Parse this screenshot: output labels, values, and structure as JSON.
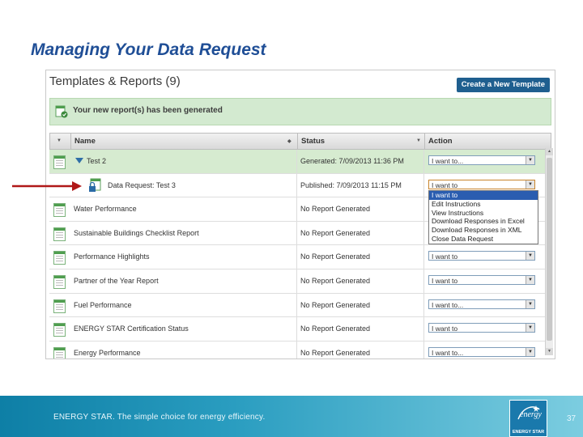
{
  "slide": {
    "title": "Managing Your Data Request",
    "page_number": "37"
  },
  "panel": {
    "title": "Templates & Reports (9)",
    "create_button": "Create a New Template",
    "banner": "Your new report(s) has been generated"
  },
  "table": {
    "headers": {
      "name": "Name",
      "status": "Status",
      "action": "Action"
    },
    "rows": [
      {
        "name": "Test 2",
        "status": "Generated: 7/09/2013 11:36 PM",
        "action": "I want to..."
      },
      {
        "name": "Data Request: Test 3",
        "status": "Published: 7/09/2013 11:15 PM",
        "action": "I want to"
      },
      {
        "name": "Water Performance",
        "status": "No Report Generated",
        "action": "I want to..."
      },
      {
        "name": "Sustainable Buildings Checklist Report",
        "status": "No Report Generated",
        "action": "I want to..."
      },
      {
        "name": "Performance Highlights",
        "status": "No Report Generated",
        "action": "I want to"
      },
      {
        "name": "Partner of the Year Report",
        "status": "No Report Generated",
        "action": "I want to"
      },
      {
        "name": "Fuel Performance",
        "status": "No Report Generated",
        "action": "I want to..."
      },
      {
        "name": "ENERGY STAR Certification Status",
        "status": "No Report Generated",
        "action": "I want to"
      },
      {
        "name": "Energy Performance",
        "status": "No Report Generated",
        "action": "I want to..."
      }
    ]
  },
  "dropdown": {
    "options": [
      "I want to",
      "Edit Instructions",
      "View Instructions",
      "Download Responses in Excel",
      "Download Responses in XML",
      "Close Data Request"
    ]
  },
  "footer": {
    "tagline": "ENERGY STAR. The simple choice for energy efficiency.",
    "logo_text": "ENERGY STAR"
  },
  "colors": {
    "title": "#1f4e96",
    "highlight_row": "#d6ebd0",
    "button": "#1f5f8f",
    "pointer": "#b01818",
    "footer": "#2a9dc0"
  }
}
